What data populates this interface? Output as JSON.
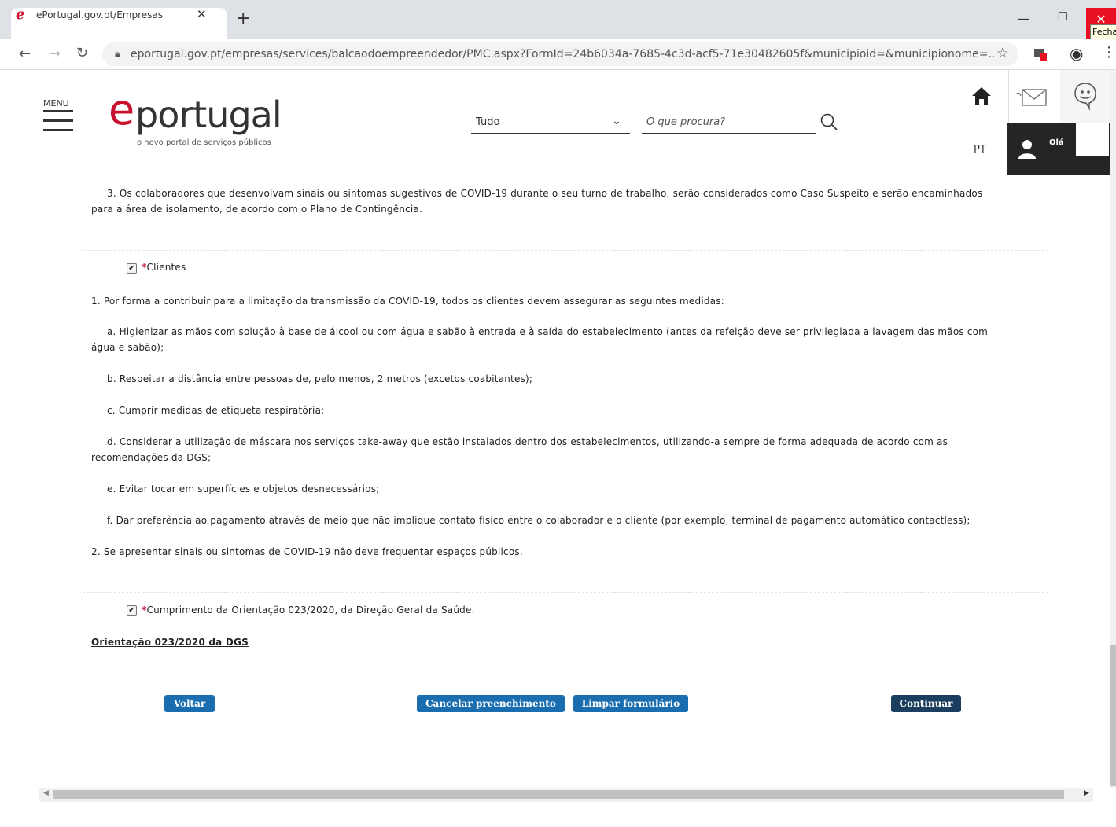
{
  "browser": {
    "tab_title": "ePortugal.gov.pt/Empresas",
    "tab_close": "✕",
    "new_tab": "+",
    "url": "eportugal.gov.pt/empresas/services/balcaodoempreendedor/PMC.aspx?FormId=24b6034a-7685-4c3d-acf5-71e30482605f&municipioid=&municipionome=...",
    "close_tooltip": "Fecha",
    "icons": [
      "back-icon",
      "forward-icon",
      "reload-icon",
      "lock-icon",
      "star-icon",
      "extension-icon",
      "profile-icon",
      "kebab-menu-icon",
      "minimize-icon",
      "maximize-icon",
      "close-icon"
    ]
  },
  "header": {
    "menu_label": "MENU",
    "logo_e": "e",
    "logo_text": "portugal",
    "logo_tagline": "o novo portal de serviços públicos",
    "search_category": "Tudo",
    "search_placeholder": "O que procura?",
    "language": "PT",
    "user_greeting": "Olá"
  },
  "content": {
    "para_3_line1": "3. Os colaboradores que desenvolvam sinais ou sintomas sugestivos de COVID-19 durante o seu turno de trabalho, serão considerados como Caso Suspeito e serão encaminhados",
    "para_3_line2": "para a área de isolamento, de acordo com o Plano de Contingência.",
    "clientes_checkbox": {
      "label": "Clientes",
      "required_mark": "*",
      "checked": true
    },
    "clientes_1": "1. Por forma a contribuir para a limitação da transmissão da COVID-19, todos os clientes devem assegurar as seguintes medidas:",
    "clientes_a_line1": "a. Higienizar as mãos com solução à base de álcool ou com água e sabão à entrada e à saída do estabelecimento (antes da refeição deve ser privilegiada a lavagem das mãos com",
    "clientes_a_line2": "água e sabão);",
    "clientes_b": "b. Respeitar a distância entre pessoas de, pelo menos, 2 metros (excetos coabitantes);",
    "clientes_c": "c. Cumprir medidas de etiqueta respiratória;",
    "clientes_d_line1": "d. Considerar a utilização de máscara nos serviços take-away que estão instalados dentro dos estabelecimentos, utilizando-a sempre de forma adequada de acordo com as",
    "clientes_d_line2": "recomendações da DGS;",
    "clientes_e": "e. Evitar tocar em superfícies e objetos desnecessários;",
    "clientes_f": "f. Dar preferência ao pagamento através de meio que não implique contato físico entre o colaborador e o cliente (por exemplo, terminal de pagamento automático contactless);",
    "clientes_2": "2. Se apresentar sinais ou sintomas de COVID-19 não deve frequentar espaços públicos.",
    "cumprimento_checkbox": {
      "label": "Cumprimento da Orientação 023/2020, da Direção Geral da Saúde.",
      "required_mark": "*",
      "checked": true
    },
    "orientacao_link": "Orientação 023/2020 da DGS"
  },
  "buttons": {
    "voltar": "Voltar",
    "cancelar": "Cancelar preenchimento",
    "limpar": "Limpar formulário",
    "continuar": "Continuar"
  },
  "colors": {
    "brand_red": "#c8102e",
    "button_blue": "#1a6eb0",
    "button_dark": "#1b3e5e",
    "user_box": "#252525"
  }
}
